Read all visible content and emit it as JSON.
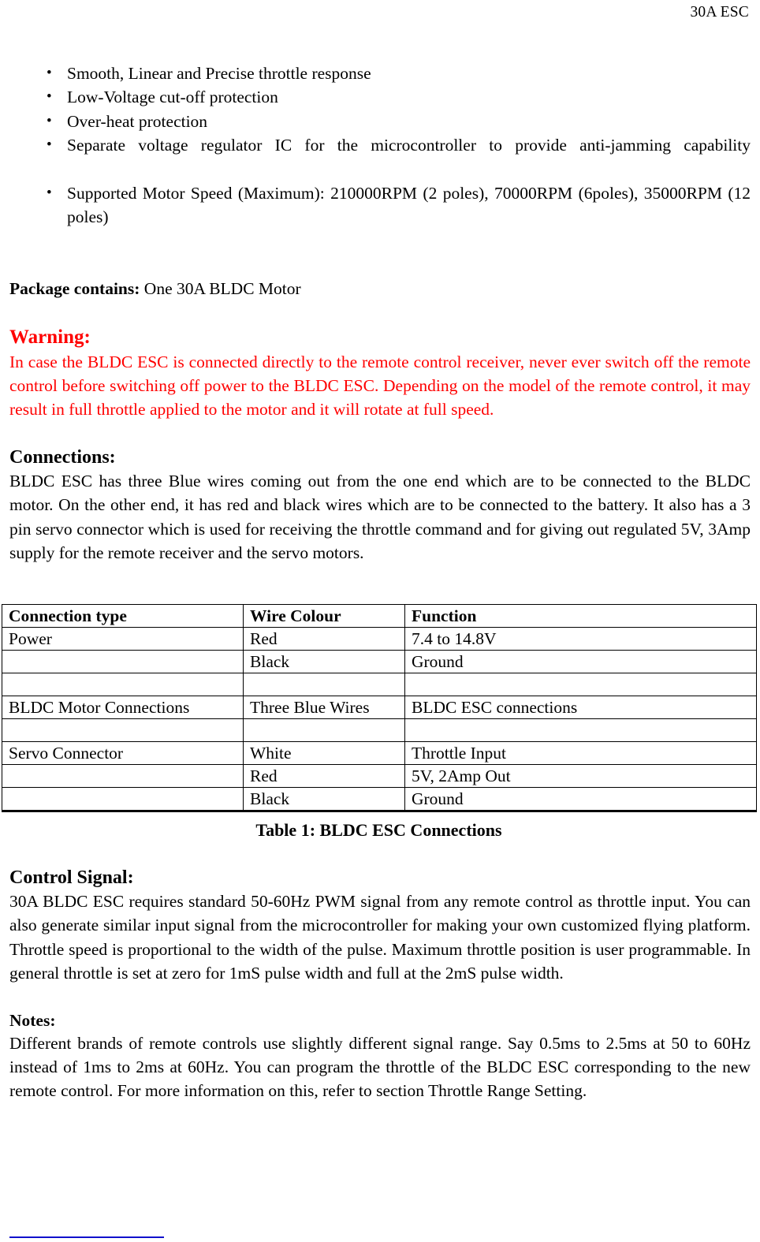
{
  "header": {
    "running_title": "30A ESC"
  },
  "features": {
    "items": [
      "Smooth, Linear and Precise throttle response",
      "Low-Voltage cut-off protection",
      "Over-heat protection",
      "Separate voltage regulator IC for the microcontroller to provide anti-jamming capability",
      "Supported Motor Speed (Maximum): 210000RPM (2 poles), 70000RPM (6poles), 35000RPM (12 poles)"
    ]
  },
  "package": {
    "label": "Package contains:",
    "value": "One 30A BLDC Motor"
  },
  "warning": {
    "heading": "Warning:",
    "body": "In case the BLDC ESC is connected directly to the remote control receiver, never ever switch off the remote control before switching off power to the BLDC ESC. Depending on the model of the remote control, it may result in full throttle applied to the motor and it will rotate at full speed.",
    "color": "#FF0000"
  },
  "connections": {
    "heading": "Connections:",
    "body": "BLDC ESC has three Blue wires coming out from the one end which are to be connected to the BLDC motor. On the other end, it has red and black wires which are to be connected to the battery. It also has a 3 pin servo connector which is used for receiving the throttle command and for giving out regulated 5V, 3Amp supply for the remote receiver and the servo motors."
  },
  "table": {
    "headers": [
      "Connection type",
      "Wire Colour",
      "Function"
    ],
    "rows": [
      [
        "Power",
        "Red",
        "7.4 to 14.8V"
      ],
      [
        "",
        "Black",
        "Ground"
      ],
      [
        "",
        "",
        ""
      ],
      [
        "BLDC Motor Connections",
        "Three Blue Wires",
        "BLDC ESC connections"
      ],
      [
        "",
        "",
        ""
      ],
      [
        "Servo Connector",
        "White",
        "Throttle Input"
      ],
      [
        "",
        "Red",
        "5V, 2Amp Out"
      ],
      [
        "",
        "Black",
        "Ground"
      ]
    ],
    "caption": "Table 1: BLDC ESC Connections"
  },
  "control_signal": {
    "heading": "Control Signal:",
    "body": "30A BLDC ESC requires standard 50-60Hz PWM signal from any remote control as throttle input. You can also generate similar input signal from the microcontroller for making your own customized flying platform. Throttle speed is proportional to the width of the pulse. Maximum throttle position is user programmable. In general throttle is set at zero for 1mS pulse width and full at the 2mS pulse width."
  },
  "notes": {
    "heading": "Notes:",
    "body": "Different brands of remote controls use slightly different signal range. Say 0.5ms to 2.5ms at 50 to 60Hz instead of 1ms to 2ms at 60Hz. You can program the throttle of the BLDC ESC corresponding to the new remote control. For more information on this, refer to section Throttle Range Setting.",
    "footnote_rule_color": "#1010CC"
  },
  "bullet_glyph": "•"
}
